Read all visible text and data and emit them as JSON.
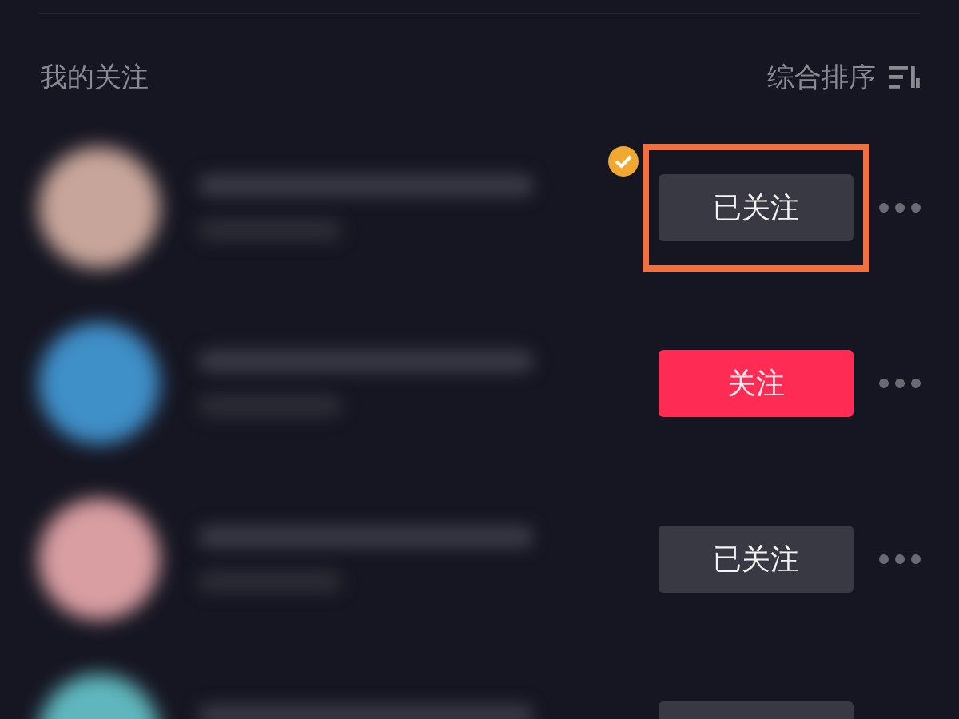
{
  "header": {
    "title": "我的关注",
    "sort_label": "综合排序"
  },
  "rows": [
    {
      "color": "#c8a59a",
      "verified": true,
      "followed": true,
      "button_label": "已关注",
      "highlighted": true
    },
    {
      "color": "#3f8fc8",
      "verified": false,
      "followed": false,
      "button_label": "关注",
      "highlighted": false
    },
    {
      "color": "#d89ea2",
      "verified": false,
      "followed": true,
      "button_label": "已关注",
      "highlighted": false
    },
    {
      "color": "#5fb7bd",
      "verified": false,
      "followed": true,
      "highlighted": false
    }
  ]
}
